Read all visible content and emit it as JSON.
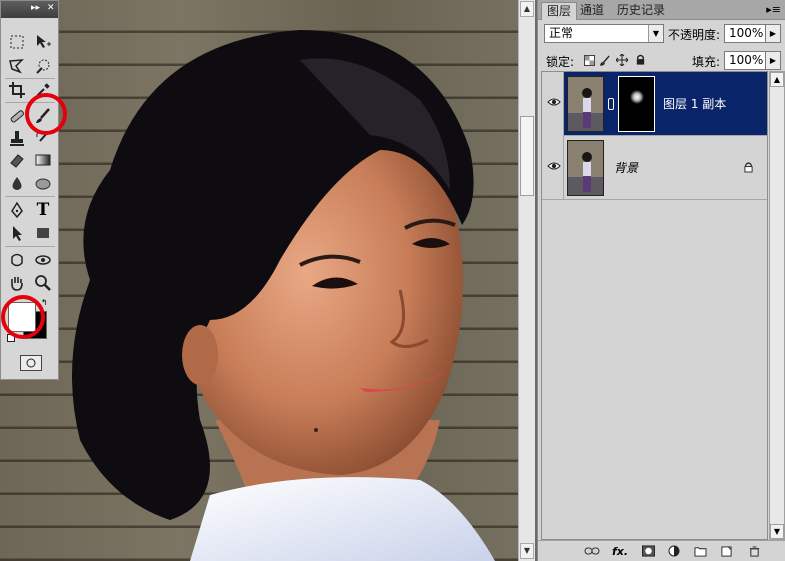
{
  "panel": {
    "tabs": [
      {
        "label": "图层",
        "active": true
      },
      {
        "label": "通道",
        "active": false
      },
      {
        "label": "历史记录",
        "active": false
      }
    ],
    "blend_mode": "正常",
    "opacity_label": "不透明度:",
    "opacity_value": "100%",
    "lock_label": "锁定:",
    "fill_label": "填充:",
    "fill_value": "100%",
    "layers": [
      {
        "name": "图层 1 副本",
        "selected": true,
        "has_mask": true
      },
      {
        "name": "背景",
        "selected": false,
        "locked": true
      }
    ],
    "bottom_icons": [
      "link-icon",
      "fx-icon",
      "mask-icon",
      "adjustment-icon",
      "group-icon",
      "new-layer-icon",
      "trash-icon"
    ],
    "fx_label": "fx."
  },
  "toolbox": {
    "type_tool_glyph": "T",
    "highlighted_tools": [
      "brush-tool",
      "color-swatches"
    ],
    "foreground_color": "#ffffff",
    "background_color": "#000000",
    "highlight_color": "#e4000c"
  },
  "colors": {
    "selection": "#0a246a",
    "panel_bg": "#d4d4d4"
  }
}
